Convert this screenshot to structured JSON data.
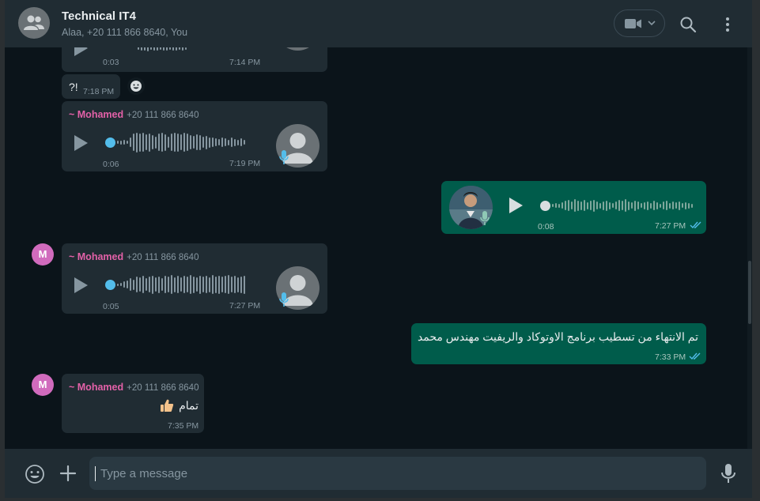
{
  "header": {
    "title": "Technical IT4",
    "subtitle": "Alaa, +20 111 866 8640, You",
    "avatar_icon": "group-icon",
    "video_icon": "video-camera-icon",
    "search_icon": "search-icon",
    "menu_icon": "more-vertical-icon"
  },
  "messages": [
    {
      "id": "voice-partial",
      "type": "voice",
      "direction": "in",
      "duration": "0:03",
      "time": "7:14 PM"
    },
    {
      "id": "text-q",
      "type": "text",
      "direction": "in",
      "text": "?!",
      "time": "7:18 PM"
    },
    {
      "id": "voice-1",
      "type": "voice",
      "direction": "in",
      "sender": "~ Mohamed",
      "phone": "+20 111 866 8640",
      "duration": "0:06",
      "time": "7:19 PM"
    },
    {
      "id": "voice-out",
      "type": "voice",
      "direction": "out",
      "duration": "0:08",
      "time": "7:27 PM",
      "status": "read"
    },
    {
      "id": "voice-2",
      "type": "voice",
      "direction": "in",
      "sender": "~ Mohamed",
      "avatar_letter": "M",
      "phone": "+20 111 866 8640",
      "duration": "0:05",
      "time": "7:27 PM"
    },
    {
      "id": "text-out",
      "type": "text",
      "direction": "out",
      "text": "تم الانتهاء من تسطيب برنامج الاوتوكاد والريفيت مهندس محمد",
      "time": "7:33 PM",
      "status": "read"
    },
    {
      "id": "text-in",
      "type": "text",
      "direction": "in",
      "sender": "~ Mohamed",
      "avatar_letter": "M",
      "phone": "+20 111 866 8640",
      "text": "تمام",
      "emoji": "thumbs-up",
      "time": "7:35 PM"
    }
  ],
  "composer": {
    "placeholder": "Type a message",
    "value": "",
    "emoji_icon": "emoji-icon",
    "attach_icon": "plus-icon",
    "mic_icon": "microphone-icon"
  },
  "colors": {
    "header_bg": "#202c33",
    "chat_bg": "#0b141a",
    "incoming_bubble": "#202c33",
    "outgoing_bubble": "#005c4b",
    "sender_name": "#e361a8",
    "read_ticks": "#53bdeb"
  }
}
